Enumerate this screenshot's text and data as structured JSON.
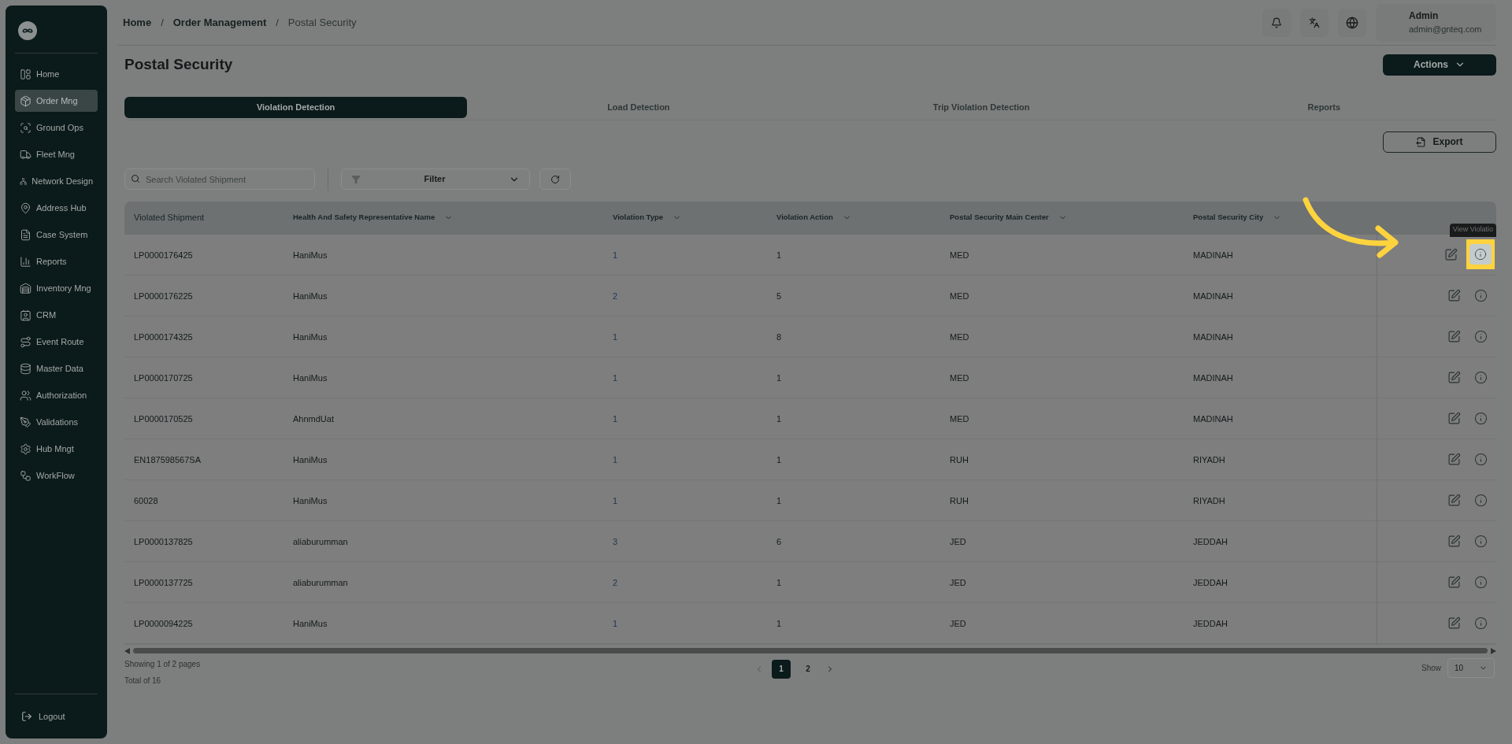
{
  "sidebar": {
    "items": [
      {
        "label": "Home",
        "selected": false
      },
      {
        "label": "Order Mng",
        "selected": true
      },
      {
        "label": "Ground Ops",
        "selected": false
      },
      {
        "label": "Fleet Mng",
        "selected": false
      },
      {
        "label": "Network Design",
        "selected": false
      },
      {
        "label": "Address Hub",
        "selected": false
      },
      {
        "label": "Case System",
        "selected": false
      },
      {
        "label": "Reports",
        "selected": false
      },
      {
        "label": "Inventory Mng",
        "selected": false
      },
      {
        "label": "CRM",
        "selected": false
      },
      {
        "label": "Event Route",
        "selected": false
      },
      {
        "label": "Master Data",
        "selected": false
      },
      {
        "label": "Authorization",
        "selected": false
      },
      {
        "label": "Validations",
        "selected": false
      },
      {
        "label": "Hub Mngt",
        "selected": false
      },
      {
        "label": "WorkFlow",
        "selected": false
      }
    ],
    "logout": "Logout"
  },
  "breadcrumb": [
    {
      "label": "Home",
      "separator": "/"
    },
    {
      "label": "Order Management",
      "separator": "/"
    },
    {
      "label": "Postal Security"
    }
  ],
  "user": {
    "name": "Admin",
    "email": "admin@gnteq.com"
  },
  "page_title": "Postal Security",
  "actions_button": "Actions",
  "tabs": [
    {
      "label": "Violation Detection",
      "selected": true
    },
    {
      "label": "Load Detection",
      "selected": false
    },
    {
      "label": "Trip Violation Detection",
      "selected": false
    },
    {
      "label": "Reports",
      "selected": false
    }
  ],
  "export_button": "Export",
  "search": {
    "placeholder": "Search Violated Shipment"
  },
  "filter": "Filter",
  "table": {
    "columns": [
      {
        "label": "Violated Shipment",
        "sortable": false
      },
      {
        "label": "Health And Safety Representative Name",
        "sortable": true
      },
      {
        "label": "Violation Type",
        "sortable": true
      },
      {
        "label": "Violation Action",
        "sortable": true
      },
      {
        "label": "Postal Security Main Center",
        "sortable": true
      },
      {
        "label": "Postal Security City",
        "sortable": true
      }
    ],
    "rows": [
      {
        "cells": [
          "LP0000176425",
          "HaniMus",
          "1",
          "1",
          "MED",
          "MADINAH"
        ],
        "highlighted": true
      },
      {
        "cells": [
          "LP0000176225",
          "HaniMus",
          "2",
          "5",
          "MED",
          "MADINAH"
        ],
        "highlighted": false
      },
      {
        "cells": [
          "LP0000174325",
          "HaniMus",
          "1",
          "8",
          "MED",
          "MADINAH"
        ],
        "highlighted": false
      },
      {
        "cells": [
          "LP0000170725",
          "HaniMus",
          "1",
          "1",
          "MED",
          "MADINAH"
        ],
        "highlighted": false
      },
      {
        "cells": [
          "LP0000170525",
          "AhnmdUat",
          "1",
          "1",
          "MED",
          "MADINAH"
        ],
        "highlighted": false
      },
      {
        "cells": [
          "EN187598567SA",
          "HaniMus",
          "1",
          "1",
          "RUH",
          "RIYADH"
        ],
        "highlighted": false
      },
      {
        "cells": [
          "60028",
          "HaniMus",
          "1",
          "1",
          "RUH",
          "RIYADH"
        ],
        "highlighted": false
      },
      {
        "cells": [
          "LP0000137825",
          "aliaburumman",
          "3",
          "6",
          "JED",
          "JEDDAH"
        ],
        "highlighted": false
      },
      {
        "cells": [
          "LP0000137725",
          "aliaburumman",
          "2",
          "1",
          "JED",
          "JEDDAH"
        ],
        "highlighted": false
      },
      {
        "cells": [
          "LP0000094225",
          "HaniMus",
          "1",
          "1",
          "JED",
          "JEDDAH"
        ],
        "highlighted": false
      }
    ],
    "tooltip": "View Violatio"
  },
  "pagination": {
    "showing": "Showing 1 of 2 pages",
    "total": "Total of 16",
    "pages": [
      {
        "label": "1",
        "selected": true
      },
      {
        "label": "2",
        "selected": false
      }
    ],
    "show_label": "Show",
    "page_size": "10"
  }
}
